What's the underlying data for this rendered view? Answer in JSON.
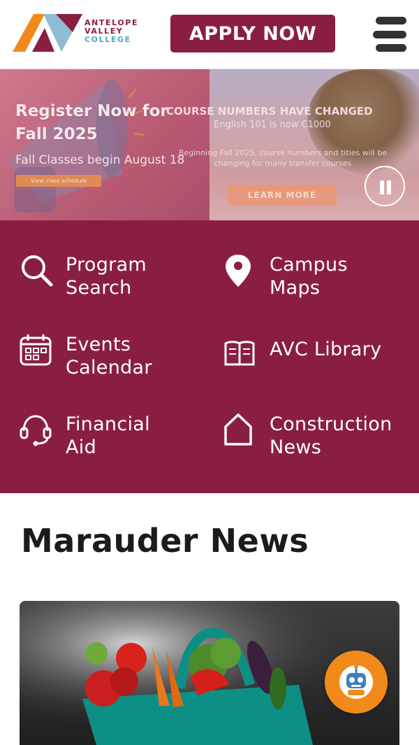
{
  "header": {
    "logo": {
      "line1": "ANTELOPE",
      "line2": "VALLEY",
      "line3": "COLLEGE"
    },
    "apply_label": "APPLY NOW"
  },
  "hero": {
    "slide1": {
      "title": "Register Now for Fall 2025",
      "subtitle": "Fall Classes begin August 18",
      "button": "View class schedule"
    },
    "slide2": {
      "title": "COURSE NUMBERS HAVE CHANGED",
      "subtitle": "English 101 is now C1000",
      "text": "Beginning Fall 2025, course numbers and titles will be changing for many transfer courses",
      "button": "LEARN MORE"
    }
  },
  "quick_links": [
    {
      "label": "Program\nSearch",
      "icon": "search-icon"
    },
    {
      "label": "Campus\nMaps",
      "icon": "map-pin-icon"
    },
    {
      "label": "Events\nCalendar",
      "icon": "calendar-icon"
    },
    {
      "label": "AVC Library",
      "icon": "book-icon"
    },
    {
      "label": "Financial\nAid",
      "icon": "headset-icon"
    },
    {
      "label": "Construction\nNews",
      "icon": "home-icon"
    }
  ],
  "news": {
    "title": "Marauder News"
  },
  "colors": {
    "brand": "#8a1e41",
    "accent_blue": "#4aa7c5",
    "chat": "#f18a1b"
  }
}
